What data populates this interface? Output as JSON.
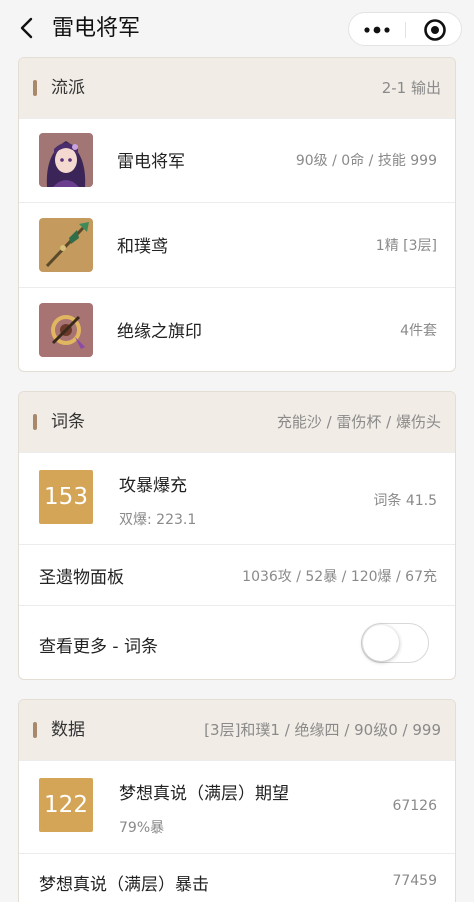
{
  "nav": {
    "title": "雷电将军"
  },
  "build": {
    "title": "流派",
    "right": "2-1 输出",
    "items": [
      {
        "name": "雷电将军",
        "meta": "90级 / 0命 / 技能 999",
        "icon": "character-portrait"
      },
      {
        "name": "和璞鸢",
        "meta": "1精 [3层]",
        "icon": "polearm-weapon"
      },
      {
        "name": "绝缘之旗印",
        "meta": "4件套",
        "icon": "artifact-set"
      }
    ]
  },
  "stats": {
    "title": "词条",
    "right": "充能沙 / 雷伤杯 / 爆伤头",
    "score": "153",
    "name": "攻暴爆充",
    "sub": "双爆: 223.1",
    "meta": "词条 41.5",
    "panel_label": "圣遗物面板",
    "panel_value": "1036攻 / 52暴 / 120爆 / 67充",
    "more_label": "查看更多 - 词条",
    "more_enabled": false
  },
  "data": {
    "title": "数据",
    "right": "[3层]和璞1 / 绝缘四 / 90级0 / 999",
    "score": "122",
    "name": "梦想真说（满层）期望",
    "sub": "79%暴",
    "value": "67126",
    "row2_label": "梦想真说（满层）暴击",
    "row2_value": "77459"
  },
  "colors": {
    "accent": "#d4a556",
    "header_bg": "#f1ece6",
    "bar": "#a8896a"
  }
}
